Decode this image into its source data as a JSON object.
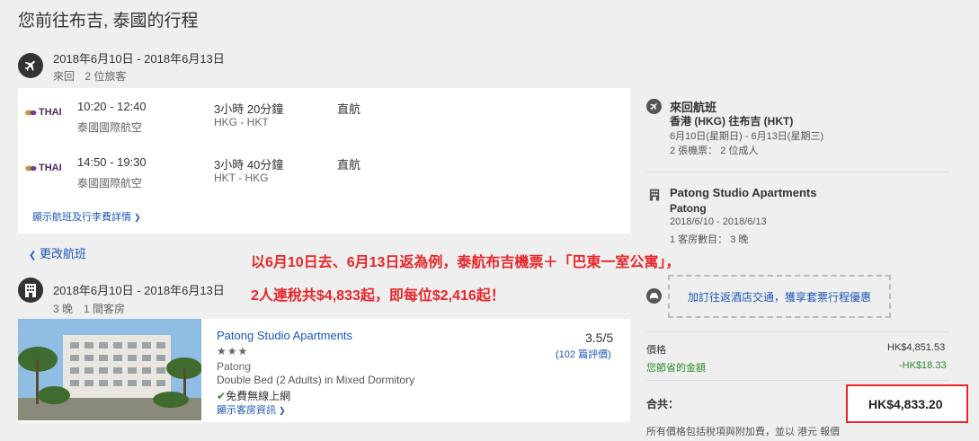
{
  "page": {
    "title": "您前往布吉, 泰國的行程"
  },
  "flight_section": {
    "dates": "2018年6月10日 - 2018年6月13日",
    "trip_type": "來回",
    "travelers": "2 位旅客",
    "segments": [
      {
        "airline_logo": "THAI",
        "times": "10:20 - 12:40",
        "airline": "泰國國際航空",
        "duration": "3小時 20分鐘",
        "route": "HKG - HKT",
        "stops": "直航"
      },
      {
        "airline_logo": "THAI",
        "times": "14:50 - 19:30",
        "airline": "泰國國際航空",
        "duration": "3小時 40分鐘",
        "route": "HKT - HKG",
        "stops": "直航"
      }
    ],
    "details_link": "顯示航班及行李費詳情",
    "change_flight": "更改航班"
  },
  "hotel_section": {
    "dates": "2018年6月10日 - 2018年6月13日",
    "nights_rooms": "3 晚　1 間客房",
    "name": "Patong Studio Apartments",
    "stars": "★★★",
    "area": "Patong",
    "room_type": "Double Bed (2 Adults) in Mixed Dormitory",
    "wifi": "免費無線上網",
    "room_details_link": "顯示客房資訊",
    "rating": "3.5/5",
    "reviews": "(102 篇評價)"
  },
  "promo": {
    "line1": "以6月10日去、6月13日返為例，泰航布吉機票＋「巴東一室公寓」，",
    "line2": "2人連稅共$4,833起，即每位$2,416起！"
  },
  "summary": {
    "flight_title": "來回航班",
    "flight_route": "香港 (HKG) 往布吉 (HKT)",
    "flight_dates": "6月10日(星期日) - 6月13日(星期三)",
    "flight_tickets": "2 張機票： 2 位成人",
    "hotel_name": "Patong Studio Apartments",
    "hotel_area": "Patong",
    "hotel_dates": "2018/6/10 - 2018/6/13",
    "hotel_rooms": "1 客房數目： 3 晚",
    "transfer_link": "加訂往返酒店交通，獲享套票行程優惠",
    "price_label": "價格",
    "price_value": "HK$4,851.53",
    "savings_label": "您節省的金額",
    "savings_value": "-HK$18.33",
    "total_label": "合共：",
    "total_value": "HK$4,833.20",
    "footnote": "所有價格包括稅項與附加費，並以 港元 報價"
  },
  "colors": {
    "promo_red": "#e8262a",
    "link_blue": "#1a56b8",
    "savings_green": "#2e8b2e"
  },
  "icons": [
    "airplane-icon",
    "building-icon",
    "car-icon",
    "chevron-left-icon",
    "chevron-down-icon",
    "check-icon"
  ]
}
